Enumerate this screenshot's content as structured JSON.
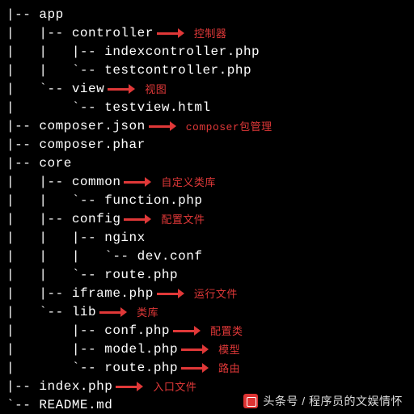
{
  "tree": [
    {
      "prefix": "|-- ",
      "name": "app",
      "note": ""
    },
    {
      "prefix": "|   |-- ",
      "name": "controller",
      "note": "控制器"
    },
    {
      "prefix": "|   |   |-- ",
      "name": "indexcontroller.php",
      "note": ""
    },
    {
      "prefix": "|   |   `-- ",
      "name": "testcontroller.php",
      "note": ""
    },
    {
      "prefix": "|   `-- ",
      "name": "view",
      "note": "视图"
    },
    {
      "prefix": "|       `-- ",
      "name": "testview.html",
      "note": ""
    },
    {
      "prefix": "|-- ",
      "name": "composer.json",
      "note": "composer包管理"
    },
    {
      "prefix": "|-- ",
      "name": "composer.phar",
      "note": ""
    },
    {
      "prefix": "|-- ",
      "name": "core",
      "note": ""
    },
    {
      "prefix": "|   |-- ",
      "name": "common",
      "note": "自定义类库"
    },
    {
      "prefix": "|   |   `-- ",
      "name": "function.php",
      "note": ""
    },
    {
      "prefix": "|   |-- ",
      "name": "config",
      "note": "配置文件"
    },
    {
      "prefix": "|   |   |-- ",
      "name": "nginx",
      "note": ""
    },
    {
      "prefix": "|   |   |   `-- ",
      "name": "dev.conf",
      "note": ""
    },
    {
      "prefix": "|   |   `-- ",
      "name": "route.php",
      "note": ""
    },
    {
      "prefix": "|   |-- ",
      "name": "iframe.php",
      "note": "运行文件"
    },
    {
      "prefix": "|   `-- ",
      "name": "lib",
      "note": "类库"
    },
    {
      "prefix": "|       |-- ",
      "name": "conf.php",
      "note": "配置类"
    },
    {
      "prefix": "|       |-- ",
      "name": "model.php",
      "note": "模型"
    },
    {
      "prefix": "|       `-- ",
      "name": "route.php",
      "note": "路由"
    },
    {
      "prefix": "|-- ",
      "name": "index.php",
      "note": "入口文件"
    },
    {
      "prefix": "`-- ",
      "name": "README.md",
      "note": ""
    }
  ],
  "footer": {
    "prefix": "头条号 / ",
    "name": "程序员的文娱情怀"
  }
}
